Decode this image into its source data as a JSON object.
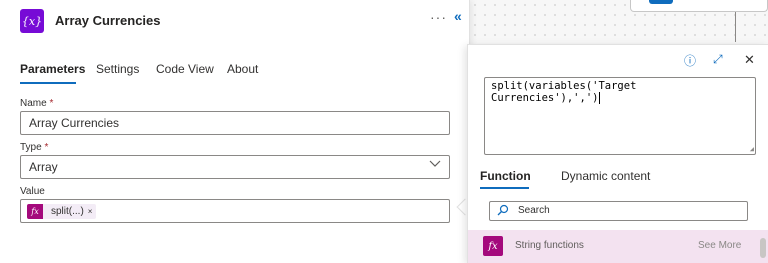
{
  "panel": {
    "title": "Array Currencies",
    "icon_glyph": "{x}",
    "more_glyph": "···",
    "collapse_glyph": "«"
  },
  "tabs": [
    "Parameters",
    "Settings",
    "Code View",
    "About"
  ],
  "fields": {
    "name_label": "Name",
    "name_value": "Array Currencies",
    "type_label": "Type",
    "type_value": "Array",
    "value_label": "Value",
    "required_mark": "*",
    "token_label": "split(...)",
    "token_icon": "fx",
    "token_remove": "×"
  },
  "popup": {
    "expression": "split(variables('Target Currencies'),',')",
    "tabs": [
      "Function",
      "Dynamic content"
    ],
    "search_placeholder": "Search",
    "function_category": "String functions",
    "function_icon": "fx",
    "see_more": "See More",
    "info_glyph": "ⓘ",
    "expand_glyph": "⤢",
    "close_glyph": "✕"
  },
  "colors": {
    "accent": "#0f6cbd",
    "action_icon": "#770bd6",
    "function_icon": "#a4097c",
    "function_row": "#f3e2f0"
  }
}
